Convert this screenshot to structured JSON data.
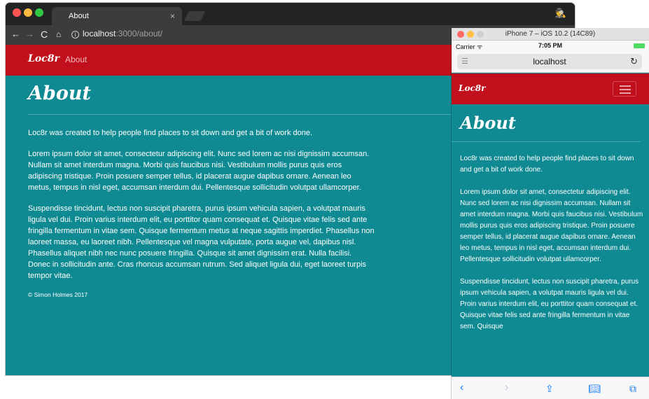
{
  "desktop": {
    "tab_title": "About",
    "tab_close": "×",
    "incognito_icon": "🕵",
    "url_host": "localhost",
    "url_path": ":3000/about/",
    "brand": "Loc8r",
    "nav_about": "About",
    "heading": "About",
    "lead": "Loc8r was created to help people find places to sit down and get a bit of work done.",
    "para1": "Lorem ipsum dolor sit amet, consectetur adipiscing elit. Nunc sed lorem ac nisi dignissim accumsan. Nullam sit amet interdum magna. Morbi quis faucibus nisi. Vestibulum mollis purus quis eros adipiscing tristique. Proin posuere semper tellus, id placerat augue dapibus ornare. Aenean leo metus, tempus in nisl eget, accumsan interdum dui. Pellentesque sollicitudin volutpat ullamcorper.",
    "para2": "Suspendisse tincidunt, lectus non suscipit pharetra, purus ipsum vehicula sapien, a volutpat mauris ligula vel dui. Proin varius interdum elit, eu porttitor quam consequat et. Quisque vitae felis sed ante fringilla fermentum in vitae sem. Quisque fermentum metus at neque sagittis imperdiet. Phasellus non laoreet massa, eu laoreet nibh. Pellentesque vel magna vulputate, porta augue vel, dapibus nisl. Phasellus aliquet nibh nec nunc posuere fringilla. Quisque sit amet dignissim erat. Nulla facilisi. Donec in sollicitudin ante. Cras rhoncus accumsan rutrum. Sed aliquet ligula dui, eget laoreet turpis tempor vitae.",
    "footer": "© Simon Holmes 2017"
  },
  "phone": {
    "sim_title": "iPhone 7 – iOS 10.2 (14C89)",
    "carrier": "Carrier ᯤ",
    "time": "7:05 PM",
    "url": "localhost",
    "brand": "Loc8r",
    "heading": "About",
    "lead": "Loc8r was created to help people find places to sit down and get a bit of work done.",
    "para1": "Lorem ipsum dolor sit amet, consectetur adipiscing elit. Nunc sed lorem ac nisi dignissim accumsan. Nullam sit amet interdum magna. Morbi quis faucibus nisi. Vestibulum mollis purus quis eros adipiscing tristique. Proin posuere semper tellus, id placerat augue dapibus ornare. Aenean leo metus, tempus in nisl eget, accumsan interdum dui. Pellentesque sollicitudin volutpat ullamcorper.",
    "para2": "Suspendisse tincidunt, lectus non suscipit pharetra, purus ipsum vehicula sapien, a volutpat mauris ligula vel dui. Proin varius interdum elit, eu porttitor quam consequat et. Quisque vitae felis sed ante fringilla fermentum in vitae sem. Quisque"
  },
  "colors": {
    "brand_red": "#c1101c",
    "teal": "#0f8a92"
  }
}
